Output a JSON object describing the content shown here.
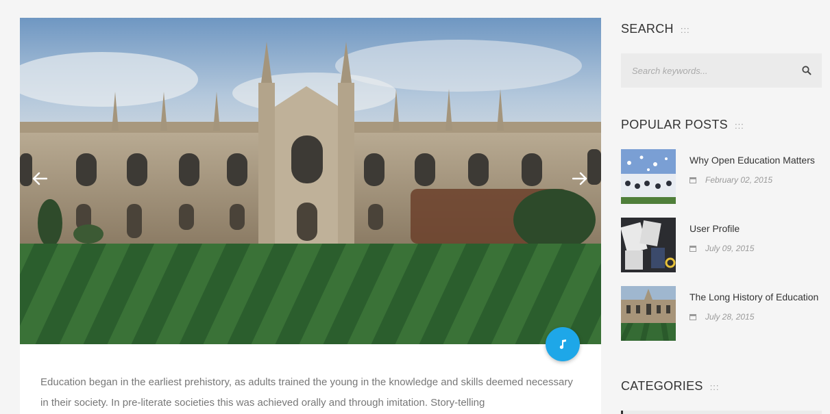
{
  "post": {
    "body_text": "Education began in the earliest prehistory, as adults trained the young in the knowledge and skills deemed necessary in their society. In pre-literate societies this was achieved orally and through imitation. Story-telling",
    "slider_prev_icon": "arrow-left-icon",
    "slider_next_icon": "arrow-right-icon",
    "media_badge_icon": "music-note-icon"
  },
  "sidebar": {
    "search": {
      "title": "SEARCH",
      "dots": ":::",
      "placeholder": "Search keywords...",
      "button_icon": "search-icon"
    },
    "popular_posts": {
      "title": "POPULAR POSTS",
      "dots": ":::",
      "items": [
        {
          "title": "Why Open Education Matters",
          "date": "February 02, 2015"
        },
        {
          "title": "User Profile",
          "date": "July 09, 2015"
        },
        {
          "title": "The Long History of Education",
          "date": "July 28, 2015"
        }
      ]
    },
    "categories": {
      "title": "CATEGORIES",
      "dots": ":::"
    }
  },
  "colors": {
    "accent": "#1ea7e8",
    "page_bg": "#f5f5f5",
    "input_bg": "#ebebeb"
  }
}
